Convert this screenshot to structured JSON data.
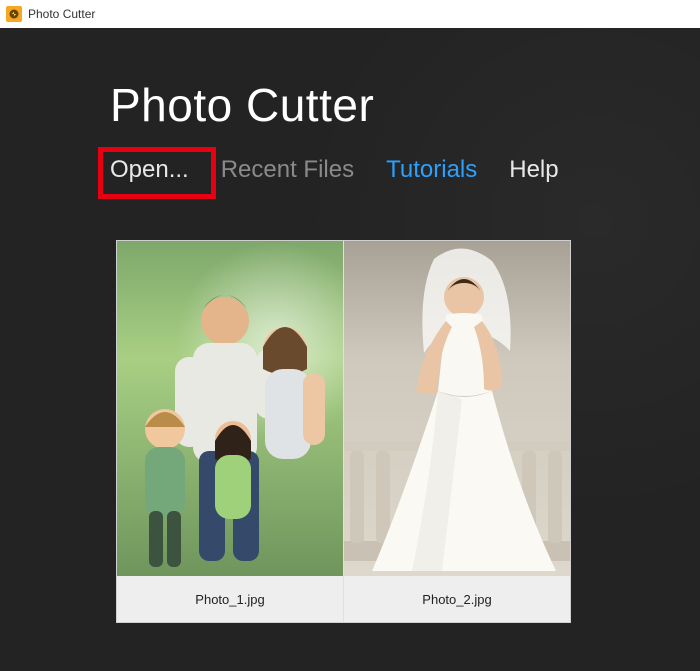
{
  "window": {
    "title": "Photo Cutter"
  },
  "app": {
    "title": "Photo Cutter"
  },
  "nav": {
    "open": "Open...",
    "recent": "Recent Files",
    "tutorials": "Tutorials",
    "help": "Help"
  },
  "thumbnails": [
    {
      "filename": "Photo_1.jpg"
    },
    {
      "filename": "Photo_2.jpg"
    }
  ],
  "colors": {
    "accent": "#2aa1ff",
    "highlight_border": "#e60012",
    "background": "#232323"
  }
}
